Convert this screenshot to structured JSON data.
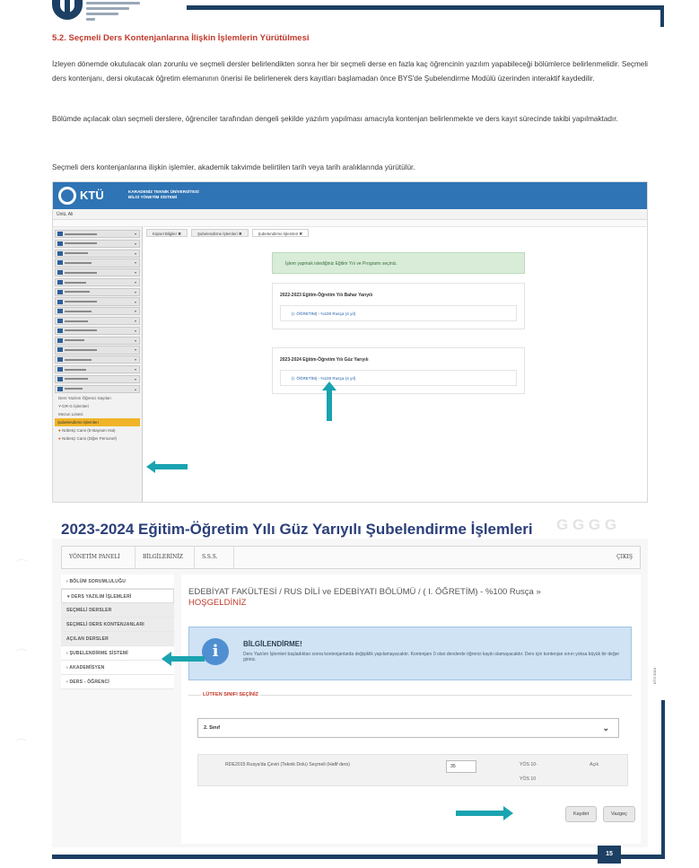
{
  "header": {
    "logo_name": "KTÜ logo"
  },
  "section": {
    "title": "5.2. Seçmeli Ders Kontenjanlarına İlişkin İşlemlerin Yürütülmesi",
    "paragraphs": [
      "İzleyen dönemde okutulacak olan zorunlu ve seçmeli dersler belirlendikten sonra her bir seçmeli derse en fazla kaç öğrencinin yazılım yapabileceği bölümlerce belirlenmelidir. Seçmeli ders kontenjanı, dersi okutacak öğretim elemanının önerisi ile belirlenerek ders kayıtları başlamadan önce BYS'de Şubelendirme Modülü üzerinden interaktif kaydedilir.",
      "Bölümde açılacak olan seçmeli derslere, öğrenciler tarafından dengeli şekilde yazılım yapılması amacıyla kontenjan belirlenmekte ve ders kayıt sürecinde takibi yapılmaktadır.",
      "Seçmeli ders kontenjanlarına ilişkin işlemler, akademik takvimde belirtilen tarih veya tarih aralıklarında yürütülür."
    ]
  },
  "shot1": {
    "logo_text": "KTÜ",
    "university_line1": "KARADENİZ TEKNİK ÜNİVERSİTESİ",
    "university_line2": "BİLGİ YÖNETİM SİSTEMİ",
    "subbar_text": "Ünlü, Ali",
    "tabs": [
      "Kişisel Bilgiler ✖",
      "Şubelendirme İşlemleri ✖",
      "Şubelendirme İşlemleri ✖"
    ],
    "sub_links": [
      "Ders Yazılım Öğrenci Sayıları",
      "Y-GR-G İşlemleri",
      "Mezun Listesi",
      "Şubelendirme İşlemleri"
    ],
    "pin_links": [
      "Nöbetçi Cami (E-Bayram Hat)",
      "Nöbetçi Cami (Diğer Personel)"
    ],
    "alert": "İşlem yapmak istediğiniz Eğitim Yılı ve Programı seçiniz.",
    "cards": [
      {
        "title": "2022-2023 Eğitim-Öğretim Yılı Bahar Yarıyılı",
        "link": "(I. ÖĞRETİM) - %100 Rusça (4 yıl)"
      },
      {
        "title": "2023-2024 Eğitim-Öğretim Yılı Güz Yarıyılı",
        "link": "(I. ÖĞRETİM) - %100 Rusça (4 yıl)"
      }
    ]
  },
  "shot2": {
    "title": "2023-2024 Eğitim-Öğretim Yılı Güz Yarıyılı Şubelendirme İşlemleri",
    "nav": [
      "YÖNETİM PANELİ",
      "BİLGİLERİNİZ",
      "S.S.S."
    ],
    "exit": "ÇIKIŞ",
    "side": [
      "› BÖLÜM SORUMLULUĞU",
      "▾ DERS YAZILIM İŞLEMLERİ",
      "SEÇMELİ DERSLER",
      "SEÇMELİ DERS KONTENJANLARI",
      "AÇILAN DERSLER",
      "› ŞUBELENDİRME SİSTEMİ",
      "› AKADEMİSYEN",
      "› DERS - ÖĞRENCİ"
    ],
    "head": "EDEBİYAT FAKÜLTESİ / RUS DİLİ ve EDEBİYATI BÖLÜMÜ / ( I. ÖĞRETİM) - %100 Rusça »",
    "welcome": "HOŞGELDİNİZ",
    "info_title": "BİLGİLENDİRME!",
    "info_text": "Ders Yazılım İşlemleri başladıktan sonra kontenjanlarda değişiklik yapılamayacaktır. Kontenjanı 0 olan derslerde öğrenci kaydı olamayacaktır. Ders için kontenjan sınırı yoksa büyük bir değer giriniz.",
    "select_legend": "LÜTFEN SINIFI SEÇİNİZ",
    "select_value": "2. Sınıf",
    "course": "RDE2015 Rusya'da Çeviri (Teknik Dolu) Seçmeli (Hafif ders)",
    "qty": "35",
    "yos1": "YÖS 10-",
    "yos2": "YÖS 10",
    "status": "Açık",
    "save_label": "Kaydet",
    "cancel_label": "Vazgeç"
  },
  "side_mark": "KTÜ 2024",
  "page_number": "15",
  "colors": {
    "accent_navy": "#1c3f63",
    "section_red": "#c0392b",
    "arrow_teal": "#1aa3b0",
    "system_blue": "#2f74b5"
  }
}
